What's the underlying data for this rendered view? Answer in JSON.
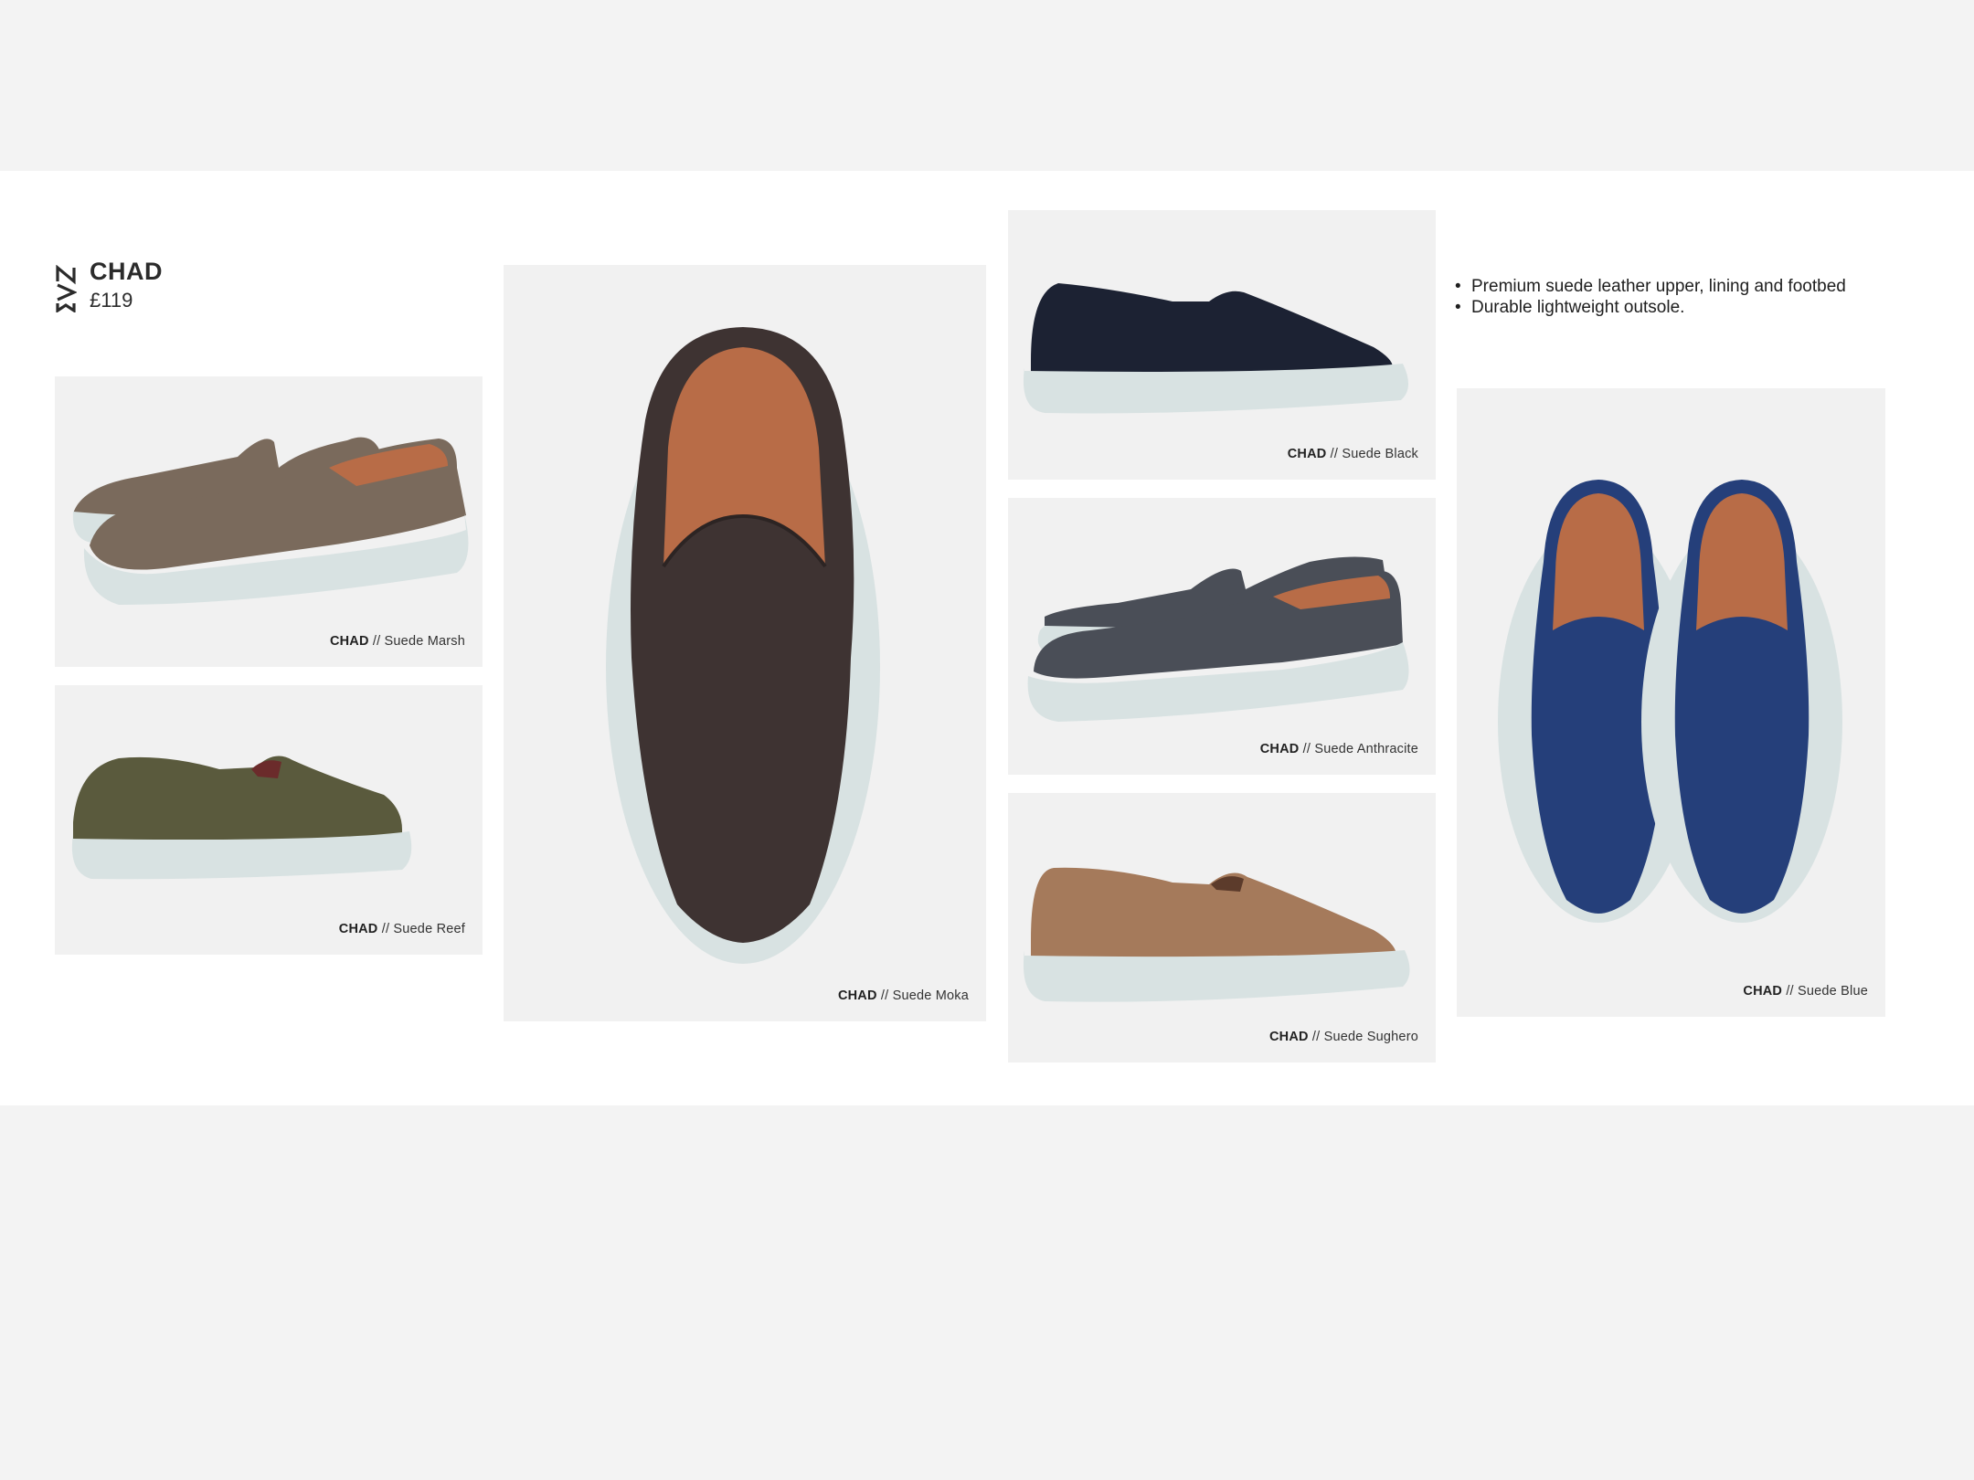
{
  "product": {
    "name": "CHAD",
    "price": "£119",
    "logo_icon": "nokwo-monogram-icon"
  },
  "features": [
    "Premium suede leather upper, lining and footbed",
    "Durable lightweight outsole."
  ],
  "variants": [
    {
      "model": "CHAD",
      "sep": " // ",
      "colour": "Suede Marsh",
      "swatch": "#7a6a5c"
    },
    {
      "model": "CHAD",
      "sep": " // ",
      "colour": "Suede Reef",
      "swatch": "#5a5a3d"
    },
    {
      "model": "CHAD",
      "sep": " // ",
      "colour": "Suede Moka",
      "swatch": "#3e3332"
    },
    {
      "model": "CHAD",
      "sep": " // ",
      "colour": "Suede Black",
      "swatch": "#1c2233"
    },
    {
      "model": "CHAD",
      "sep": " // ",
      "colour": "Suede Anthracite",
      "swatch": "#4a4e57"
    },
    {
      "model": "CHAD",
      "sep": " // ",
      "colour": "Suede Sughero",
      "swatch": "#a57a5b"
    },
    {
      "model": "CHAD",
      "sep": " // ",
      "colour": "Suede Blue",
      "swatch": "#253f7a"
    }
  ],
  "colors": {
    "page_background": "#f3f3f3",
    "sheet_background": "#ffffff",
    "card_background": "#f1f1f1",
    "sole": "#d8e2e2",
    "lining": "#b86c47"
  }
}
